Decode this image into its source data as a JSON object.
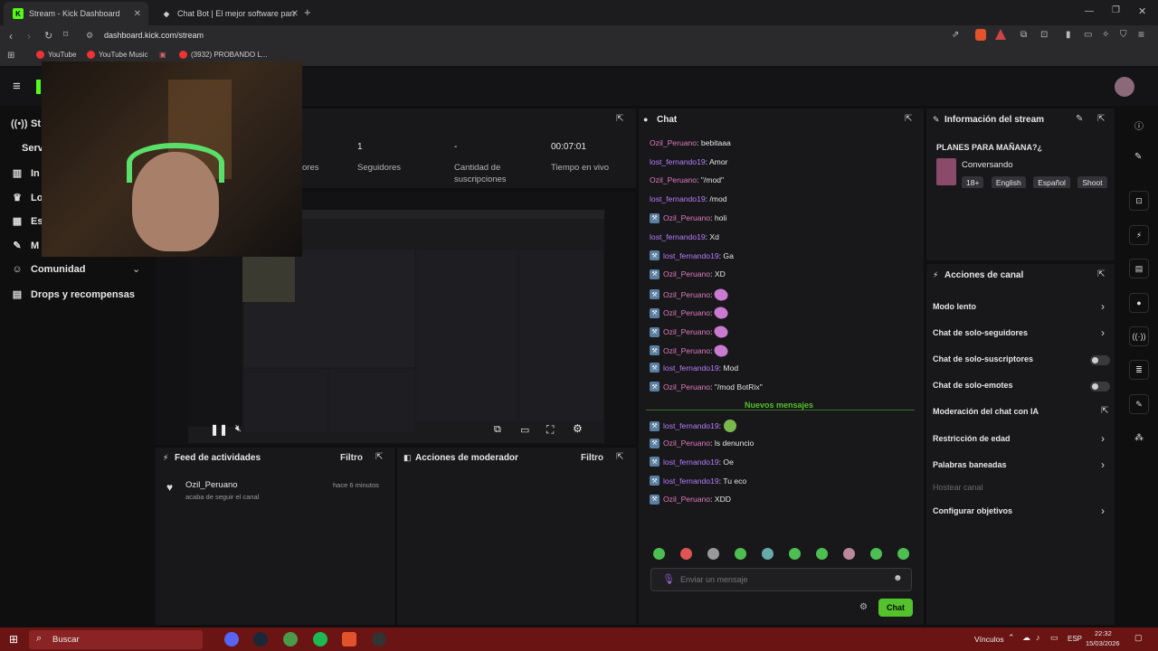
{
  "browser": {
    "tabs": [
      {
        "label": "Stream - Kick Dashboard",
        "fav": "K"
      },
      {
        "label": "Chat Bot | El mejor software para po"
      }
    ],
    "url": "dashboard.kick.com/stream",
    "bookmarks": [
      "YouTube",
      "YouTube Music",
      "(3932) PROBANDO L..."
    ]
  },
  "sidebar": {
    "items": [
      {
        "label": "St",
        "icon": "broadcast-icon"
      },
      {
        "label": "Serv",
        "icon": "server-icon"
      },
      {
        "label": "In",
        "icon": "chart-icon"
      },
      {
        "label": "Lo",
        "icon": "trophy-icon"
      },
      {
        "label": "Es",
        "icon": "calendar-icon"
      },
      {
        "label": "M",
        "icon": "wrench-icon"
      },
      {
        "label": "Comunidad",
        "icon": "users-icon"
      },
      {
        "label": "Drops y recompensas",
        "icon": "gift-icon"
      }
    ]
  },
  "stats": {
    "viewers_label": "ores",
    "followers_value": "1",
    "followers_label": "Seguidores",
    "subs_value": "-",
    "subs_label": "Cantidad de suscripciones",
    "time_value": "00:07:01",
    "time_label": "Tiempo en vivo"
  },
  "feed": {
    "title": "Feed de actividades",
    "filter": "Filtro",
    "item_user": "Ozil_Peruano",
    "item_time": "hace 6 minutos",
    "item_text": "acaba de seguir el canal"
  },
  "moderator": {
    "title": "Acciones de moderador",
    "filter": "Filtro"
  },
  "chat": {
    "title": "Chat",
    "messages": [
      {
        "user": "Ozil_Peruano",
        "text": ": bebitaaa",
        "badge": false
      },
      {
        "user": "lost_fernando19",
        "text": ": Amor",
        "badge": false
      },
      {
        "user": "Ozil_Peruano",
        "text": ": \"/mod\"",
        "badge": false
      },
      {
        "user": "lost_fernando19",
        "text": ": /mod",
        "badge": false
      },
      {
        "user": "Ozil_Peruano",
        "text": ": holi",
        "badge": true
      },
      {
        "user": "lost_fernando19",
        "text": ": Xd",
        "badge": false
      },
      {
        "user": "lost_fernando19",
        "text": ": Ga",
        "badge": true
      },
      {
        "user": "Ozil_Peruano",
        "text": ": XD",
        "badge": true
      },
      {
        "user": "Ozil_Peruano",
        "text": ":",
        "badge": true,
        "emote": "pink"
      },
      {
        "user": "Ozil_Peruano",
        "text": ":",
        "badge": true,
        "emote": "pink"
      },
      {
        "user": "Ozil_Peruano",
        "text": ":",
        "badge": true,
        "emote": "pink"
      },
      {
        "user": "Ozil_Peruano",
        "text": ":",
        "badge": true,
        "emote": "pink"
      },
      {
        "user": "lost_fernando19",
        "text": ": Mod",
        "badge": true
      },
      {
        "user": "Ozil_Peruano",
        "text": ": \"/mod BotRix\"",
        "badge": true
      }
    ],
    "new_messages_label": "Nuevos mensajes",
    "new_messages": [
      {
        "user": "lost_fernando19",
        "text": ":",
        "badge": true,
        "emote": "green"
      },
      {
        "user": "Ozil_Peruano",
        "text": ": ls denuncio",
        "badge": true
      },
      {
        "user": "lost_fernando19",
        "text": ": Oe",
        "badge": true
      },
      {
        "user": "lost_fernando19",
        "text": ": Tu eco",
        "badge": true
      },
      {
        "user": "Ozil_Peruano",
        "text": ": XDD",
        "badge": true
      }
    ],
    "input_placeholder": "Enviar un mensaje",
    "send_label": "Chat"
  },
  "stream_info": {
    "title": "Información del stream",
    "stream_title": "PLANES PARA MAÑANA?¿",
    "category": "Conversando",
    "tags": [
      "18+",
      "English",
      "Español",
      "Shoot"
    ]
  },
  "channel_actions": {
    "title": "Acciones de canal",
    "items": [
      {
        "label": "Modo lento",
        "control": "chevron"
      },
      {
        "label": "Chat de solo-seguidores",
        "control": "chevron"
      },
      {
        "label": "Chat de solo-suscriptores",
        "control": "toggle"
      },
      {
        "label": "Chat de solo-emotes",
        "control": "toggle"
      },
      {
        "label": "Moderación del chat con IA",
        "control": "external"
      },
      {
        "label": "Restricción de edad",
        "control": "chevron"
      },
      {
        "label": "Palabras baneadas",
        "control": "chevron"
      },
      {
        "label": "Hostear canal",
        "control": "none",
        "disabled": true
      },
      {
        "label": "Configurar objetivos",
        "control": "chevron"
      }
    ]
  },
  "taskbar": {
    "search_placeholder": "Buscar",
    "links_label": "Vínculos",
    "lang": "ESP",
    "time": "22:32",
    "date": "15/03/2026"
  },
  "colors": {
    "kick_green": "#53fc18",
    "send_button": "#53c22b",
    "ozil": "#e07ac0",
    "lost": "#b77cff",
    "taskbar": "#6b1414"
  }
}
